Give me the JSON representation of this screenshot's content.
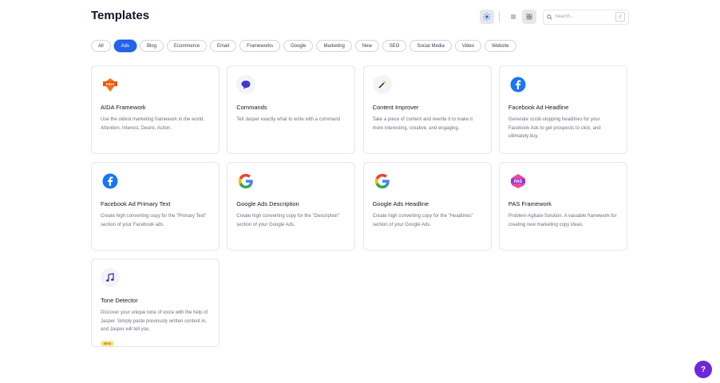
{
  "header": {
    "title": "Templates",
    "search_placeholder": "Search...",
    "search_shortcut": "/"
  },
  "filters": [
    {
      "label": "All",
      "selected": false
    },
    {
      "label": "Ads",
      "selected": true
    },
    {
      "label": "Blog",
      "selected": false
    },
    {
      "label": "Ecommerce",
      "selected": false
    },
    {
      "label": "Email",
      "selected": false
    },
    {
      "label": "Frameworks",
      "selected": false
    },
    {
      "label": "Google",
      "selected": false
    },
    {
      "label": "Marketing",
      "selected": false
    },
    {
      "label": "New",
      "selected": false
    },
    {
      "label": "SEO",
      "selected": false
    },
    {
      "label": "Social Media",
      "selected": false
    },
    {
      "label": "Video",
      "selected": false
    },
    {
      "label": "Website",
      "selected": false
    }
  ],
  "templates": [
    {
      "title": "AIDA Framework",
      "description": "Use the oldest marketing framework in the world. Attention, Interest, Desire, Action.",
      "icon": "aida-icon",
      "icon_text": "AIDA"
    },
    {
      "title": "Commands",
      "description": "Tell Jasper exactly what to write with a command",
      "icon": "speech-bubble-icon"
    },
    {
      "title": "Content Improver",
      "description": "Take a piece of content and rewrite it to make it more interesting, creative, and engaging.",
      "icon": "magic-wand-icon"
    },
    {
      "title": "Facebook Ad Headline",
      "description": "Generate scroll-stopping headlines for your Facebook Ads to get prospects to click, and ultimately buy.",
      "icon": "facebook-icon"
    },
    {
      "title": "Facebook Ad Primary Text",
      "description": "Create high converting copy for the \"Primary Text\" section of your Facebook ads.",
      "icon": "facebook-icon"
    },
    {
      "title": "Google Ads Description",
      "description": "Create high converting copy for the \"Description\" section of your Google Ads.",
      "icon": "google-icon"
    },
    {
      "title": "Google Ads Headline",
      "description": "Create high converting copy for the \"Headlines\" section of your Google Ads.",
      "icon": "google-icon"
    },
    {
      "title": "PAS Framework",
      "description": "Problem-Agitate-Solution. A valuable framework for creating new marketing copy ideas.",
      "icon": "pas-icon",
      "icon_text": "PAS"
    },
    {
      "title": "Tone Detector",
      "description": "Discover your unique tone of voice with the help of Jasper. Simply paste previously written content in, and Jasper will tell you.",
      "icon": "music-note-icon",
      "badge": "Beta"
    }
  ],
  "help_label": "?",
  "colors": {
    "accent": "#2563eb",
    "help": "#6d28d9",
    "facebook": "#1877f2"
  }
}
